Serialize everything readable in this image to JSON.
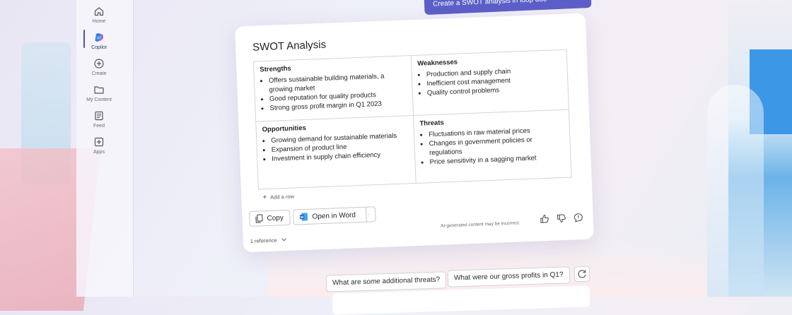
{
  "rail": {
    "items": [
      {
        "label": "Home",
        "icon": "home-icon"
      },
      {
        "label": "Copilot",
        "icon": "copilot-icon"
      },
      {
        "label": "Create",
        "icon": "create-icon"
      },
      {
        "label": "My Content",
        "icon": "folder-icon"
      },
      {
        "label": "Feed",
        "icon": "feed-icon"
      },
      {
        "label": "Apps",
        "icon": "apps-icon"
      }
    ],
    "active": "Copilot"
  },
  "prompt": {
    "text": "Create a SWOT analysis in loop doc"
  },
  "card": {
    "title": "SWOT Analysis",
    "swot": {
      "strengths": {
        "heading": "Strengths",
        "items": [
          "Offers sustainable building materials, a growing market",
          "Good reputation for quality products",
          "Strong gross profit margin in Q1 2023"
        ]
      },
      "weaknesses": {
        "heading": "Weaknesses",
        "items": [
          "Production and supply chain",
          "Inefficient cost management",
          "Quality control problems"
        ]
      },
      "opportunities": {
        "heading": "Opportunities",
        "items": [
          "Growing demand for sustainable materials",
          "Expansion of product line",
          "Investment in supply chain efficiency"
        ]
      },
      "threats": {
        "heading": "Threats",
        "items": [
          "Fluctuations in raw material prices",
          "Changes in government policies or regulations",
          "Price sensitivity in a sagging market"
        ]
      }
    },
    "add_row_label": "Add a row",
    "copy_label": "Copy",
    "open_word_label": "Open in Word",
    "reference_label": "1 reference",
    "disclaimer": "AI-generated content may be incorrect."
  },
  "suggestions": [
    "What are some additional threats?",
    "What were our gross profits in Q1?"
  ],
  "colors": {
    "accent": "#5b5fc7",
    "word_blue": "#185abd",
    "active_bar": "#4b53bc"
  }
}
